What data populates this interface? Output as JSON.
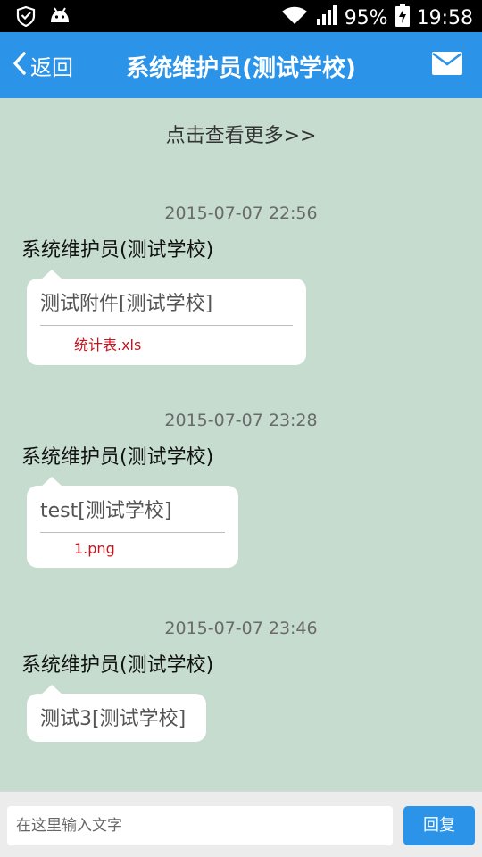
{
  "status_bar": {
    "battery": "95%",
    "time": "19:58",
    "icons": [
      "shield-icon",
      "android-icon",
      "wifi-icon",
      "signal-icon",
      "battery-charging-icon"
    ]
  },
  "header": {
    "back_label": "返回",
    "title": "系统维护员(测试学校)",
    "icons": [
      "chevron-left-icon",
      "mail-icon"
    ]
  },
  "chat": {
    "load_more": "点击查看更多>>",
    "messages": [
      {
        "time": "2015-07-07 22:56",
        "sender": "系统维护员(测试学校)",
        "text": "测试附件[测试学校]",
        "attachment": "统计表.xls"
      },
      {
        "time": "2015-07-07 23:28",
        "sender": "系统维护员(测试学校)",
        "text": "test[测试学校]",
        "attachment": "1.png"
      },
      {
        "time": "2015-07-07 23:46",
        "sender": "系统维护员(测试学校)",
        "text": "测试3[测试学校]"
      }
    ]
  },
  "input_bar": {
    "placeholder": "在这里输入文字",
    "value": "",
    "reply_label": "回复"
  },
  "colors": {
    "accent": "#2b93e8",
    "chat_background": "#c5dccf",
    "attachment_text": "#c8141e"
  }
}
